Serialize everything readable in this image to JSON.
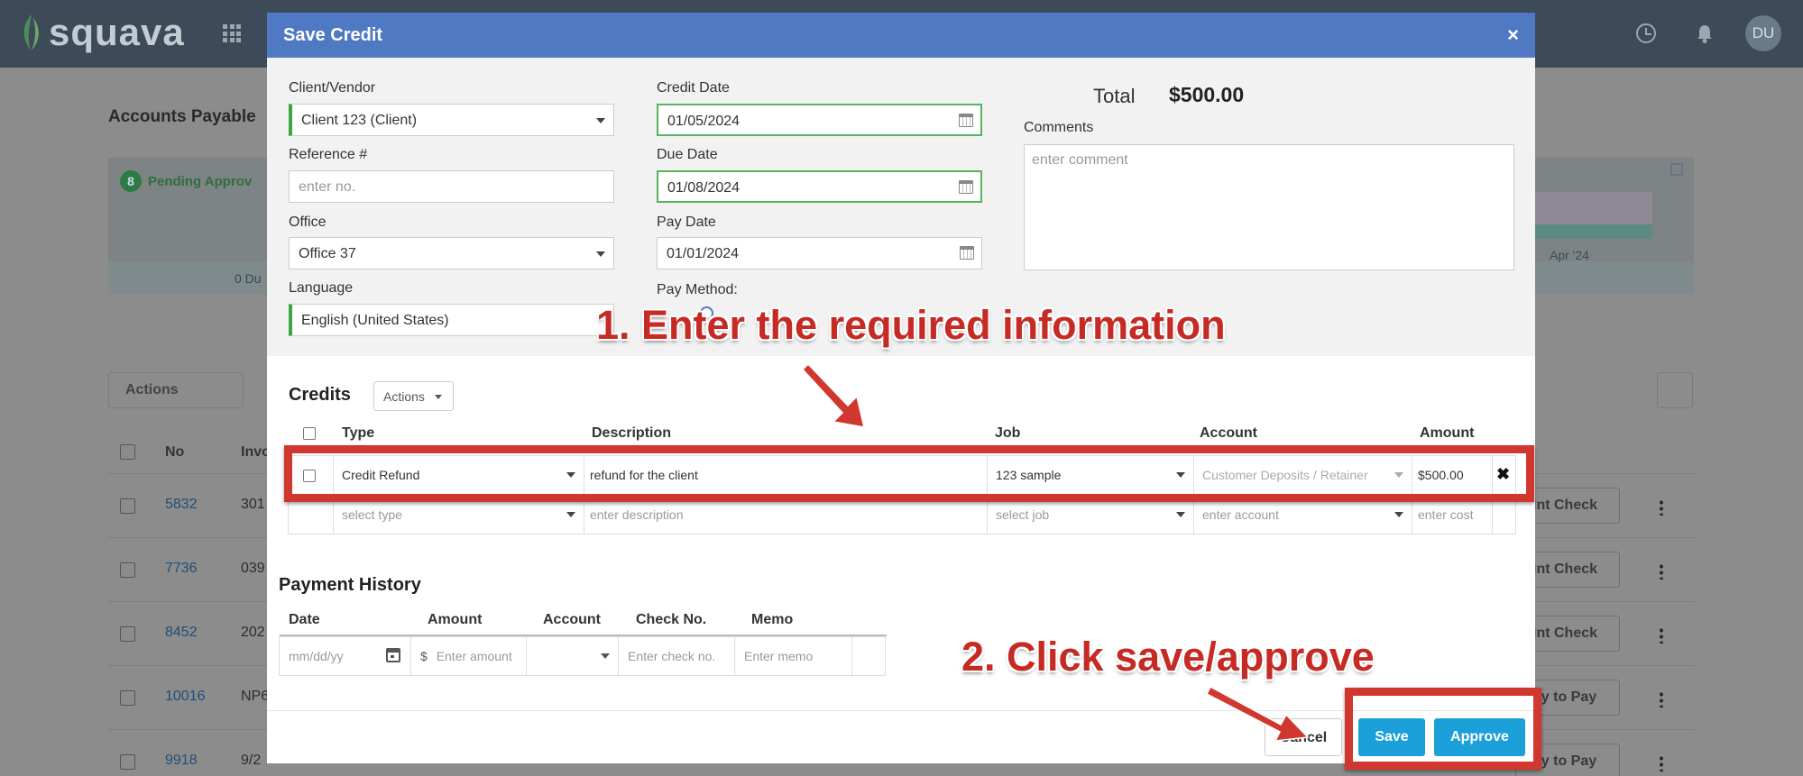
{
  "app": {
    "logo_text": "squava",
    "avatar_initials": "DU"
  },
  "background": {
    "page_title": "Accounts Payable",
    "pending_count": "8",
    "pending_label": "Pending Approv",
    "due_label": "0 Du",
    "chart_month": "Apr '24",
    "actions_label": "Actions",
    "col_no": "No",
    "col_inv": "Invo",
    "rows": [
      {
        "no": "5832",
        "inv": "301",
        "btn": "int Check"
      },
      {
        "no": "7736",
        "inv": "039",
        "btn": "int Check"
      },
      {
        "no": "8452",
        "inv": "202",
        "btn": "int Check"
      },
      {
        "no": "10016",
        "inv": "NP6",
        "btn": "dy to Pay"
      },
      {
        "no": "9918",
        "inv": "9/2",
        "btn": "dy to Pay"
      }
    ]
  },
  "modal": {
    "title": "Save Credit",
    "close": "×",
    "client_vendor_label": "Client/Vendor",
    "client_vendor_value": "Client 123 (Client)",
    "reference_label": "Reference #",
    "reference_placeholder": "enter no.",
    "office_label": "Office",
    "office_value": "Office 37",
    "language_label": "Language",
    "language_value": "English (United States)",
    "credit_date_label": "Credit Date",
    "credit_date_value": "01/05/2024",
    "due_date_label": "Due Date",
    "due_date_value": "01/08/2024",
    "pay_date_label": "Pay Date",
    "pay_date_value": "01/01/2024",
    "pay_method_label": "Pay Method:",
    "total_label": "Total",
    "total_value": "$500.00",
    "comments_label": "Comments",
    "comments_placeholder": "enter comment",
    "credits_title": "Credits",
    "credits_actions": "Actions",
    "credits_headers": {
      "type": "Type",
      "description": "Description",
      "job": "Job",
      "account": "Account",
      "amount": "Amount"
    },
    "credit_row": {
      "type": "Credit Refund",
      "description": "refund for the client",
      "job": "123 sample",
      "account": "Customer Deposits / Retainer",
      "amount": "$500.00",
      "remove": "✖"
    },
    "new_row": {
      "type": "select type",
      "description": "enter description",
      "job": "select job",
      "account": "enter account",
      "amount": "enter cost"
    },
    "payment_history_title": "Payment History",
    "payment_headers": {
      "date": "Date",
      "amount": "Amount",
      "account": "Account",
      "check_no": "Check No.",
      "memo": "Memo"
    },
    "payment_row": {
      "date": "mm/dd/yy",
      "currency": "$",
      "amount": "Enter amount",
      "check_no": "Enter check no.",
      "memo": "Enter memo"
    },
    "cancel_label": "Cancel",
    "save_label": "Save",
    "approve_label": "Approve"
  },
  "annotations": {
    "step1": "1. Enter the required information",
    "step2": "2. Click save/approve",
    "color": "#d0382f"
  },
  "colors": {
    "header_blue": "#4f79c2",
    "button_blue": "#1ba0d9",
    "topbar": "#3d4a57",
    "required_green": "#3ea645"
  }
}
